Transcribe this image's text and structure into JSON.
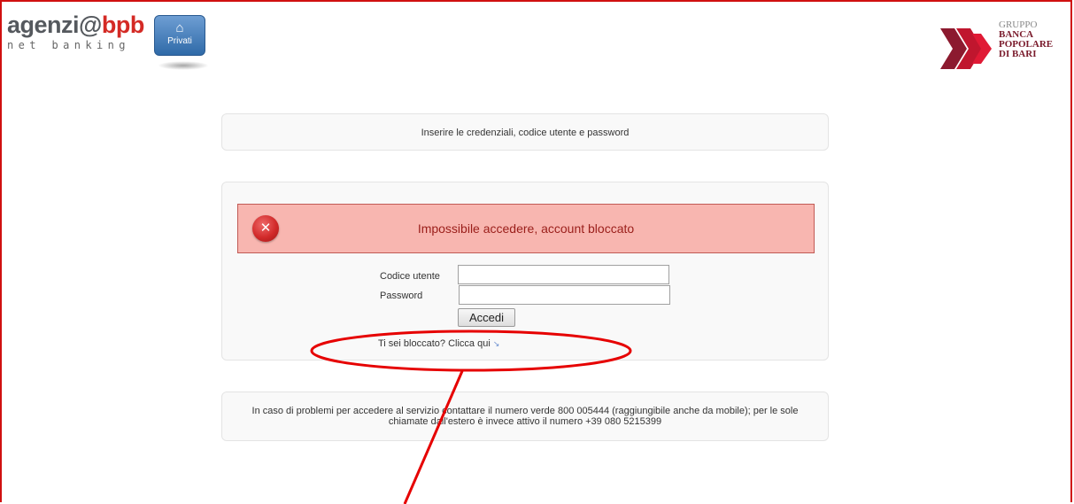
{
  "header": {
    "logo_main": "agenzi@",
    "logo_brand": "bpb",
    "logo_sub": "net banking",
    "privati_label": "Privati",
    "home_icon": "home-icon"
  },
  "bank_logo": {
    "lines": [
      "GRUPPO",
      "BANCA",
      "POPOLARE",
      "DI BARI"
    ]
  },
  "instructions": "Inserire le credenziali, codice utente e password",
  "login": {
    "error_message": "Impossibile accedere, account bloccato",
    "error_icon": "error-x-icon",
    "username_label": "Codice utente",
    "username_value": "",
    "password_label": "Password",
    "password_value": "",
    "submit_label": "Accedi",
    "help_text": "Ti sei bloccato? Clicca qui",
    "help_arrow": "↘"
  },
  "footer": {
    "contact_text": "In caso di problemi per accedere al servizio contattare il numero verde 800 005444 (raggiungibile anche da mobile); per le sole chiamate dall'estero è invece attivo il numero +39 080 5215399"
  },
  "colors": {
    "brand_red": "#d42a25",
    "alert_bg": "#f8b6b0",
    "alert_text": "#9a1e1a",
    "annotation_red": "#e60000",
    "frame_red": "#d01010"
  }
}
